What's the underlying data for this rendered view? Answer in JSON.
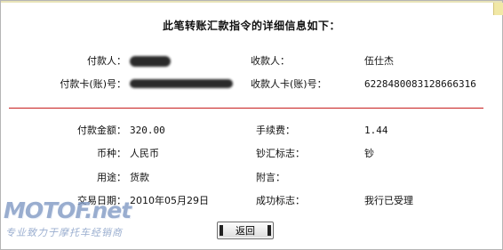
{
  "title": "此笔转账汇款指令的详细信息如下：",
  "payer": {
    "name_label": "付款人：",
    "account_label": "付款卡(账)号："
  },
  "payee": {
    "name_label": "收款人：",
    "name_value": "伍仕杰",
    "account_label": "收款人卡(账)号：",
    "account_value": "6228480083128666316"
  },
  "details": {
    "amount_label": "付款金额：",
    "amount_value": "320.00",
    "fee_label": "手续费：",
    "fee_value": "1.44",
    "currency_label": "币种：",
    "currency_value": "人民币",
    "cash_flag_label": "钞汇标志：",
    "cash_flag_value": "钞",
    "purpose_label": "用途：",
    "purpose_value": "货款",
    "note_label": "附言：",
    "note_value": "",
    "date_label": "交易日期：",
    "date_value": "2010年05月29日",
    "status_label": "成功标志：",
    "status_value": "我行已受理"
  },
  "back_button": "返回",
  "watermark": {
    "logo": "MOTOF.net",
    "tagline": "专业致力于摩托车经销商"
  },
  "colors": {
    "divider": "#c81e1e",
    "watermark": "#7d97c2",
    "top_strip": "#e8e3b8"
  }
}
